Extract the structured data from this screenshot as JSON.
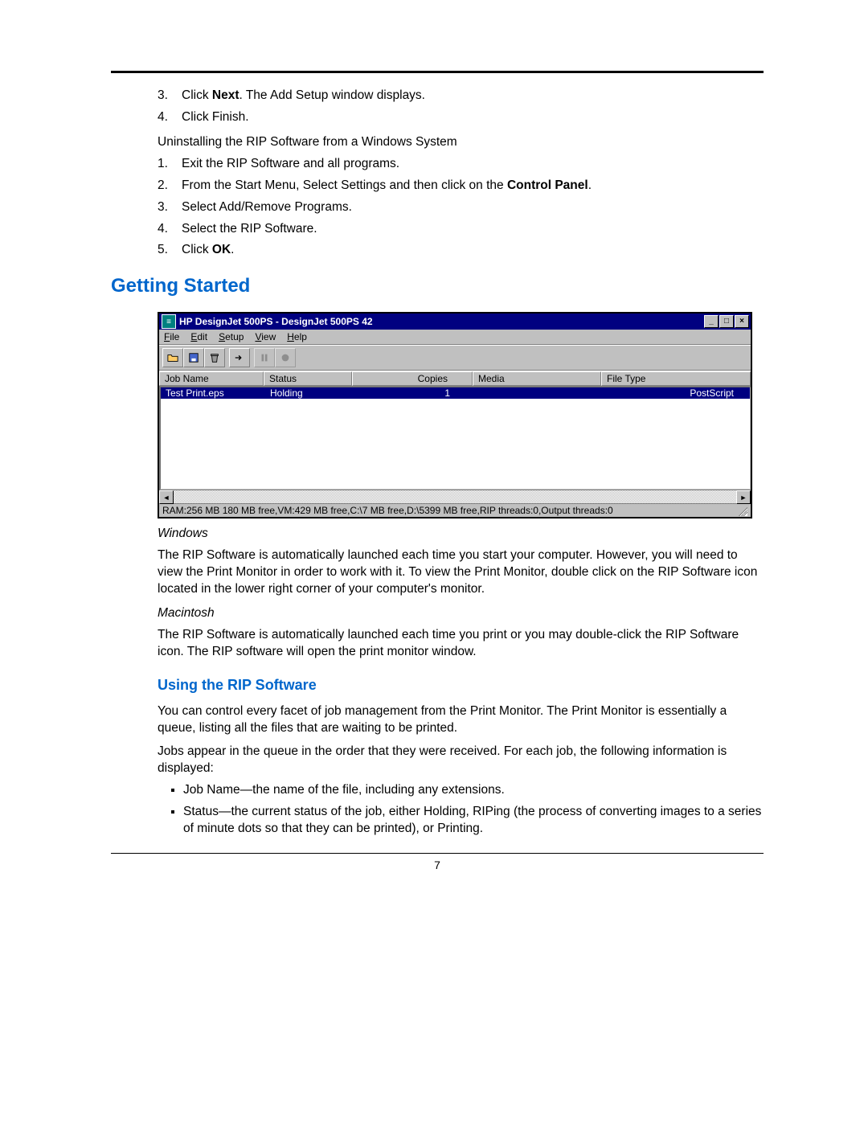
{
  "top_list": {
    "items": [
      {
        "prefix": "3.",
        "text_before": "Click ",
        "bold": "Next",
        "text_after": ". The Add Setup window displays."
      },
      {
        "prefix": "4.",
        "text_before": "Click Finish.",
        "bold": "",
        "text_after": ""
      }
    ]
  },
  "uninstall": {
    "heading": "Uninstalling the RIP Software from a Windows System",
    "items": [
      {
        "prefix": "1.",
        "text_before": "Exit the RIP Software and all programs.",
        "bold": "",
        "text_after": ""
      },
      {
        "prefix": "2.",
        "text_before": "From the Start Menu, Select Settings and then click on the ",
        "bold": "Control Panel",
        "text_after": "."
      },
      {
        "prefix": "3.",
        "text_before": "Select Add/Remove Programs.",
        "bold": "",
        "text_after": ""
      },
      {
        "prefix": "4.",
        "text_before": "Select the RIP Software.",
        "bold": "",
        "text_after": ""
      },
      {
        "prefix": "5.",
        "text_before": "Click ",
        "bold": "OK",
        "text_after": "."
      }
    ]
  },
  "h1": "Getting Started",
  "screenshot": {
    "title": "HP DesignJet 500PS - DesignJet 500PS 42",
    "menus": {
      "file": "File",
      "edit": "Edit",
      "setup": "Setup",
      "view": "View",
      "help": "Help"
    },
    "columns": {
      "c1": "Job Name",
      "c2": "Status",
      "c3": "Copies",
      "c4": "Media",
      "c5": "File Type"
    },
    "row": {
      "job": "Test Print.eps",
      "status": "Holding",
      "copies": "1",
      "media": "",
      "filetype": "PostScript"
    },
    "status": "RAM:256 MB 180 MB free,VM:429 MB free,C:\\7 MB free,D:\\5399 MB free,RIP threads:0,Output threads:0"
  },
  "windows_section": {
    "heading": "Windows",
    "body": "The RIP Software is automatically launched each time you start your computer. However, you will need to view the Print Monitor in order to work with it. To view the Print Monitor, double click on the RIP Software icon located in the lower right corner of your computer's monitor."
  },
  "mac_section": {
    "heading": "Macintosh",
    "body": "The RIP Software is automatically launched each time you print or you may double-click the RIP Software icon. The RIP software will open the print monitor window."
  },
  "h2": "Using the RIP Software",
  "p1": "You can control every facet of job management from the Print Monitor. The Print Monitor is essentially a queue, listing all the files that are waiting to be printed.",
  "p2": "Jobs appear in the queue in the order that they were received. For each job, the following information is displayed:",
  "bullets": [
    "Job Name—the name of the file, including any extensions.",
    "Status—the current status of the job, either Holding, RIPing (the process of converting images to a series of minute dots so that they can be printed), or Printing."
  ],
  "pagenum": "7"
}
